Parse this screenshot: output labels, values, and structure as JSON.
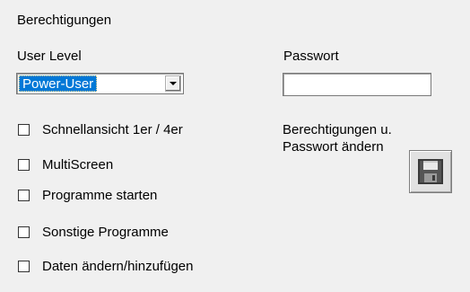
{
  "group": {
    "title": "Berechtigungen"
  },
  "user_level": {
    "label": "User Level",
    "selected": "Power-User"
  },
  "password": {
    "label": "Passwort",
    "value": ""
  },
  "permissions": [
    {
      "label": "Schnellansicht 1er / 4er",
      "checked": false
    },
    {
      "label": "MultiScreen",
      "checked": false
    },
    {
      "label": "Programme starten",
      "checked": false
    },
    {
      "label": "Sonstige Programme",
      "checked": false
    },
    {
      "label": "Daten ändern/hinzufügen",
      "checked": false
    }
  ],
  "save": {
    "line1": "Berechtigungen u.",
    "line2": "Passwort ändern",
    "icon": "floppy-disk-icon"
  },
  "colors": {
    "background": "#f0f0f0",
    "selection": "#0078d7"
  }
}
